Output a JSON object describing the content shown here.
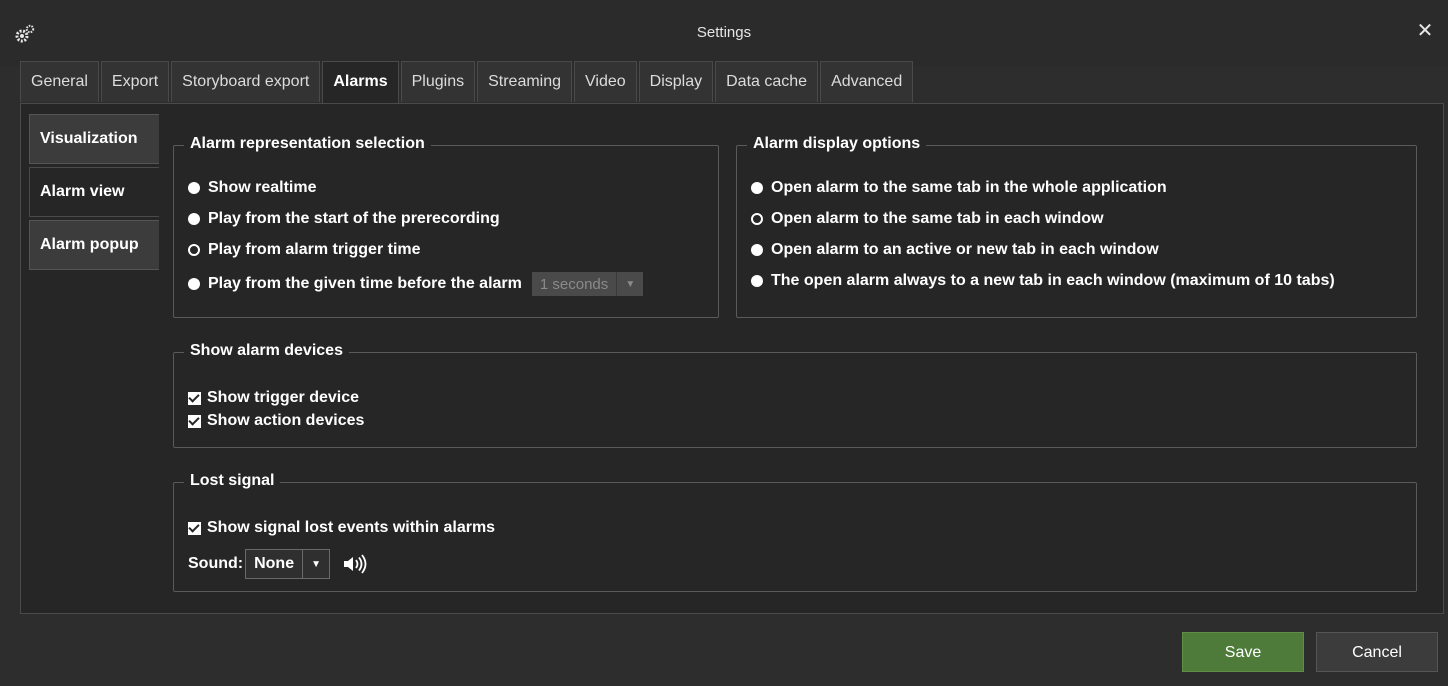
{
  "window": {
    "title": "Settings",
    "close_glyph": "✕"
  },
  "tabs": [
    {
      "label": "General"
    },
    {
      "label": "Export"
    },
    {
      "label": "Storyboard export"
    },
    {
      "label": "Alarms",
      "active": true
    },
    {
      "label": "Plugins"
    },
    {
      "label": "Streaming"
    },
    {
      "label": "Video"
    },
    {
      "label": "Display"
    },
    {
      "label": "Data cache"
    },
    {
      "label": "Advanced"
    }
  ],
  "side_tabs": [
    {
      "label": "Visualization"
    },
    {
      "label": "Alarm view",
      "active": true
    },
    {
      "label": "Alarm popup"
    }
  ],
  "representation": {
    "title": "Alarm representation selection",
    "options": [
      {
        "label": "Show realtime",
        "selected": true
      },
      {
        "label": "Play from the start of the prerecording",
        "selected": true
      },
      {
        "label": "Play from alarm trigger time",
        "selected": false
      },
      {
        "label": "Play from the given time before the alarm",
        "selected": true
      }
    ],
    "time_value": "1 seconds"
  },
  "display_options": {
    "title": "Alarm display options",
    "options": [
      {
        "label": "Open alarm to the same tab in the whole application",
        "selected": true
      },
      {
        "label": "Open alarm to the same tab in each window",
        "selected": false
      },
      {
        "label": "Open alarm to an active or new tab in each window",
        "selected": true
      },
      {
        "label": "The open alarm always to a new tab in each window (maximum of 10 tabs)",
        "selected": true
      }
    ]
  },
  "devices": {
    "title": "Show alarm devices",
    "trigger": "Show trigger device",
    "action": "Show action devices"
  },
  "lost_signal": {
    "title": "Lost signal",
    "checkbox": "Show signal lost events within alarms",
    "sound_label": "Sound:",
    "sound_value": "None"
  },
  "buttons": {
    "save": "Save",
    "cancel": "Cancel"
  },
  "colors": {
    "save_bg": "#4e7b3a",
    "panel_bg": "#262626"
  }
}
